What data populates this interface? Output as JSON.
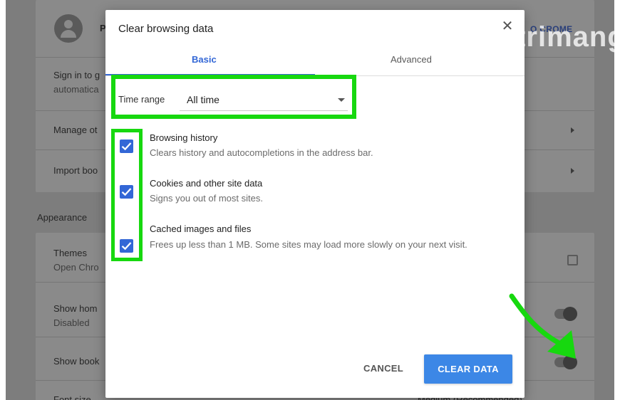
{
  "background": {
    "profile_initial": "P",
    "profile_link": "O CROME",
    "rows": [
      {
        "title": "Sign in to g",
        "subtitle": "automatica"
      },
      {
        "title": "Manage ot"
      },
      {
        "title": "Import boo"
      }
    ],
    "section_heading": "Appearance",
    "appearance_rows": [
      {
        "title": "Themes",
        "subtitle": "Open Chro"
      },
      {
        "title": "Show hom",
        "subtitle": "Disabled"
      },
      {
        "title": "Show book"
      },
      {
        "title": "Font size",
        "value": "Medium (Recommended)"
      }
    ],
    "watermark": "uantrimang"
  },
  "dialog": {
    "title": "Clear browsing data",
    "close_glyph": "✕",
    "tabs": [
      {
        "label": "Basic",
        "active": true
      },
      {
        "label": "Advanced",
        "active": false
      }
    ],
    "time_range": {
      "label": "Time range",
      "value": "All time"
    },
    "options": [
      {
        "title": "Browsing history",
        "description": "Clears history and autocompletions in the address bar.",
        "checked": true
      },
      {
        "title": "Cookies and other site data",
        "description": "Signs you out of most sites.",
        "checked": true
      },
      {
        "title": "Cached images and files",
        "description": "Frees up less than 1 MB. Some sites may load more slowly on your next visit.",
        "checked": true
      }
    ],
    "buttons": {
      "cancel": "CANCEL",
      "clear": "CLEAR DATA"
    }
  },
  "colors": {
    "accent": "#3367d6",
    "primary_button": "#3c87e6",
    "highlight": "#17d80f"
  },
  "icons": {
    "close": "close-icon",
    "dropdown": "chevron-down-icon",
    "check": "checkmark-icon",
    "external": "external-link-icon",
    "avatar": "avatar-icon"
  }
}
